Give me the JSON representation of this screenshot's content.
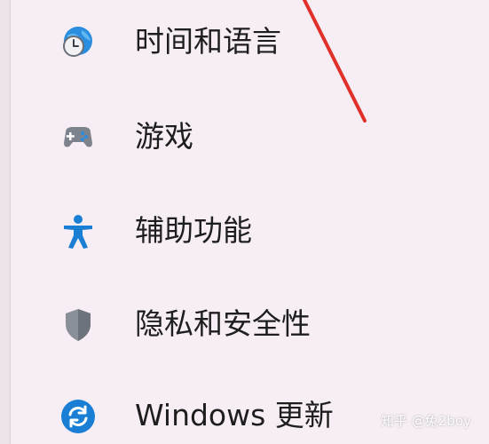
{
  "nav": {
    "items": [
      {
        "label": "时间和语言",
        "icon": "globe-clock-icon"
      },
      {
        "label": "游戏",
        "icon": "gamepad-icon"
      },
      {
        "label": "辅助功能",
        "icon": "accessibility-icon"
      },
      {
        "label": "隐私和安全性",
        "icon": "shield-icon"
      },
      {
        "label": "Windows 更新",
        "icon": "windows-update-icon"
      }
    ]
  },
  "watermark": {
    "text": "知乎 @兔2boy"
  },
  "colors": {
    "background": "#f6eef4",
    "annotation_arrow": "#e0302a",
    "accent_blue": "#1a7fd4"
  }
}
